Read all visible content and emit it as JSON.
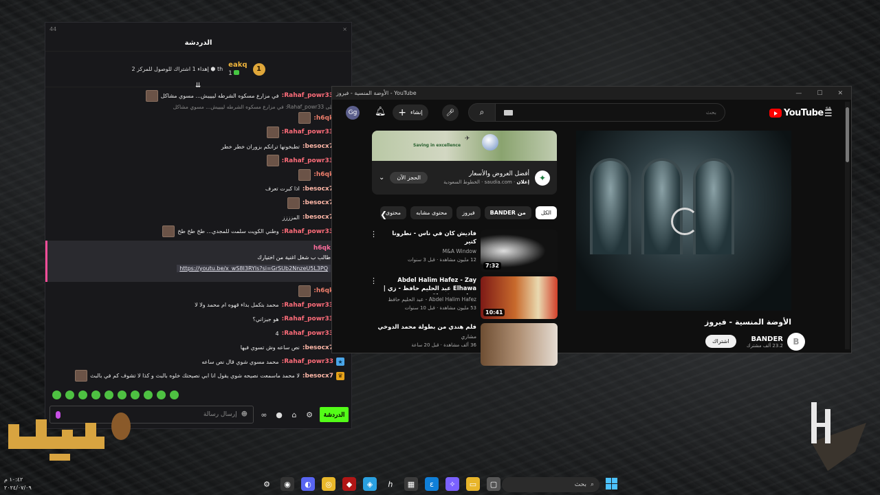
{
  "chat": {
    "window_number": "44",
    "close": "×",
    "title": "الدردشة",
    "pinned": {
      "medal": "1",
      "user": "eakq",
      "count": "1",
      "text": "إهداء 1 اشتراك للوصول للمركز 2 ⬢ th"
    },
    "messages": [
      {
        "badge": "blue",
        "user": "Rahaf_powr33:",
        "text": "في مزارع مسكوه الشرطه لييييش... مسوي مشاكل",
        "emote": true
      },
      {
        "small": true,
        "text": "الرد على Rahaf_powr33: في مزارع مسكوه الشرطه لييييش... مسوي مشاكل"
      },
      {
        "badge": "blue",
        "user": "h6qk:",
        "text": "",
        "emote": true
      },
      {
        "badge": "blue",
        "user": "Rahaf_powr33:",
        "text": "",
        "emote": true
      },
      {
        "badge": "crown",
        "user": "besocx7:",
        "text": "تطبخونها ترانكم بزوران خطر خطر"
      },
      {
        "badge": "blue",
        "user": "Rahaf_powr33:",
        "text": "",
        "emote": true
      },
      {
        "badge": "blue",
        "user": "h6qk:",
        "text": "",
        "emote": true
      },
      {
        "badge": "crown",
        "user": "besocx7:",
        "text": "اذا كبرت تعرف"
      },
      {
        "badge": "crown",
        "user": "besocx7:",
        "text": "",
        "emote": true
      },
      {
        "badge": "crown",
        "user": "besocx7:",
        "text": "المزززز"
      },
      {
        "badge": "blue",
        "user": "Rahaf_powr33:",
        "text": "وطني الكويت سلمت للمجدي... طخ طخ طخ",
        "emote": true
      }
    ],
    "highlight": {
      "user": "h6qk",
      "text": "طالب ب شغل اغنية من اختيارك",
      "link": "https://youtu.be/x_wS8I3RYls?si=GrSUb2NnzeU5L3PQ"
    },
    "messages2": [
      {
        "badge": "blue",
        "user": "h6qk:",
        "text": "",
        "emote": true
      },
      {
        "badge": "blue",
        "user": "Rahaf_powr33:",
        "text": "محمد بتكمل بداء قهوه ام محمد ولا لا"
      },
      {
        "badge": "blue",
        "user": "Rahaf_powr33:",
        "text": "هو جيزاني؟"
      },
      {
        "badge": "blue",
        "user": "Rahaf_powr33:",
        "text": "4"
      },
      {
        "badge": "crown",
        "user": "besocx7:",
        "text": "نص ساعه وش تسوي فيها"
      },
      {
        "badge": "blue",
        "user": "Rahaf_powr33:",
        "text": "محمد مسوي شوي قال نص ساعه"
      },
      {
        "badge": "crown",
        "user": "besocx7:",
        "text": "لا محمد ماسمعت نصيحه شوي يقول انا ابي نصيحتك خلوه بالبث و كذا لا تشوف كم في بالبث",
        "emote": true
      }
    ],
    "input_placeholder": "إرسال رسالة",
    "send_label": "الدردشة"
  },
  "youtube": {
    "window_title": "الأوضة المنسية - فيروز - YouTube",
    "avatar": "Gg",
    "create_label": "إنشاء",
    "search_placeholder": "بحث",
    "logo_text": "YouTube",
    "logo_region": "SA",
    "ad": {
      "banner_text": "Saving in excellence",
      "title": "أفضل العروض والأسعار",
      "sponsor_label": "إعلان",
      "url": "saudia.com · الخطوط السعودية",
      "cta": "الحجز الآن"
    },
    "chips": [
      "الكل",
      "من BANDER",
      "فيروز",
      "محتوى مشابه",
      "محتوى"
    ],
    "videos": [
      {
        "title": "فاديش كان في ناس - نطرونا كتير",
        "channel": "M&A Window",
        "meta": "12 مليون مشاهدة · قبل 3 سنوات",
        "duration": "7:32"
      },
      {
        "title": "Abdel Halim Hafez - Zay Elhawa عبد الحليم حافظ - زي | Short version",
        "channel": "Abdel Halim Hafez - عبد الحليم حافظ",
        "meta": "53 مليون مشاهدة · قبل 10 سنوات",
        "duration": "10:41"
      },
      {
        "title": "فلم هندي من بطولة محمد الدوخي",
        "channel": "مشاري",
        "meta": "36 ألف مشاهدة · قبل 20 ساعة",
        "duration": ""
      }
    ],
    "video_title": "الأوضة المنسية - فيروز",
    "channel_name": "BANDER",
    "channel_subs": "23.2 ألف مشترك",
    "subscribe_label": "اشتراك"
  },
  "taskbar": {
    "search_placeholder": "بحث",
    "time": "١٠:٤٢ م",
    "date": "٢٠٢٤/٠٧/٠٩"
  }
}
